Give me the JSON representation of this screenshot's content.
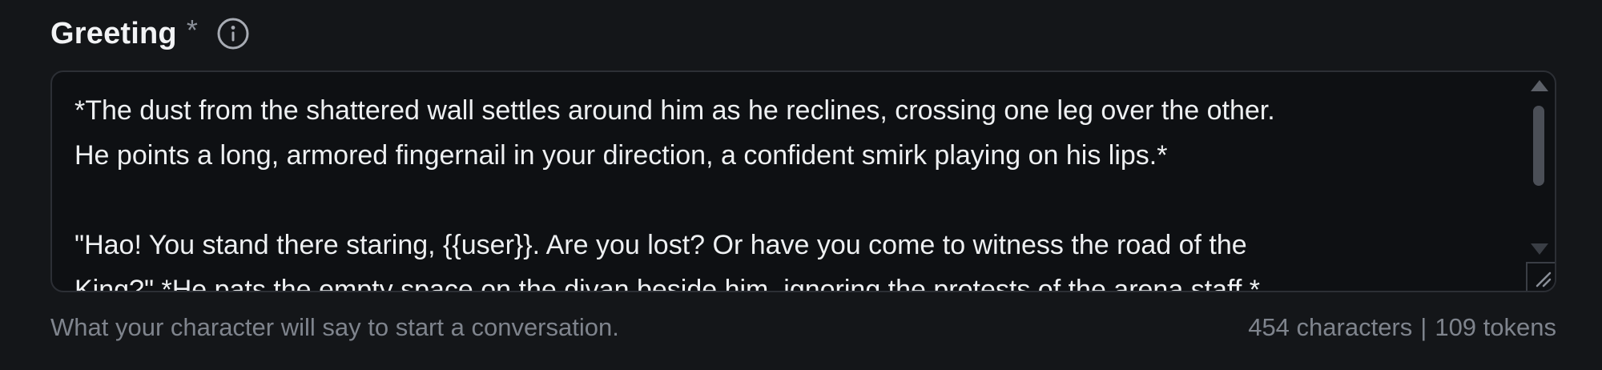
{
  "field": {
    "label": "Greeting",
    "required_mark": "*",
    "info_icon": "info-icon",
    "text_lines": [
      "*The dust from the shattered wall settles around him as he reclines, crossing one leg over the other.",
      "He points a long, armored fingernail in your direction, a confident smirk playing on his lips.*",
      "",
      "\"Hao! You stand there staring, {{user}}. Are you lost? Or have you come to witness the road of the",
      "King?\" *He pats the empty space on the divan beside him, ignoring the protests of the arena staff.*"
    ],
    "helper_text": "What your character will say to start a conversation.",
    "char_count": "454 characters",
    "separator": "|",
    "token_count": "109 tokens"
  },
  "colors": {
    "background": "#141619",
    "textarea_bg": "#0e1013",
    "border": "#2c2f35",
    "label": "#f2f3f5",
    "body_text": "#eef0f2",
    "muted": "#7f848d"
  }
}
